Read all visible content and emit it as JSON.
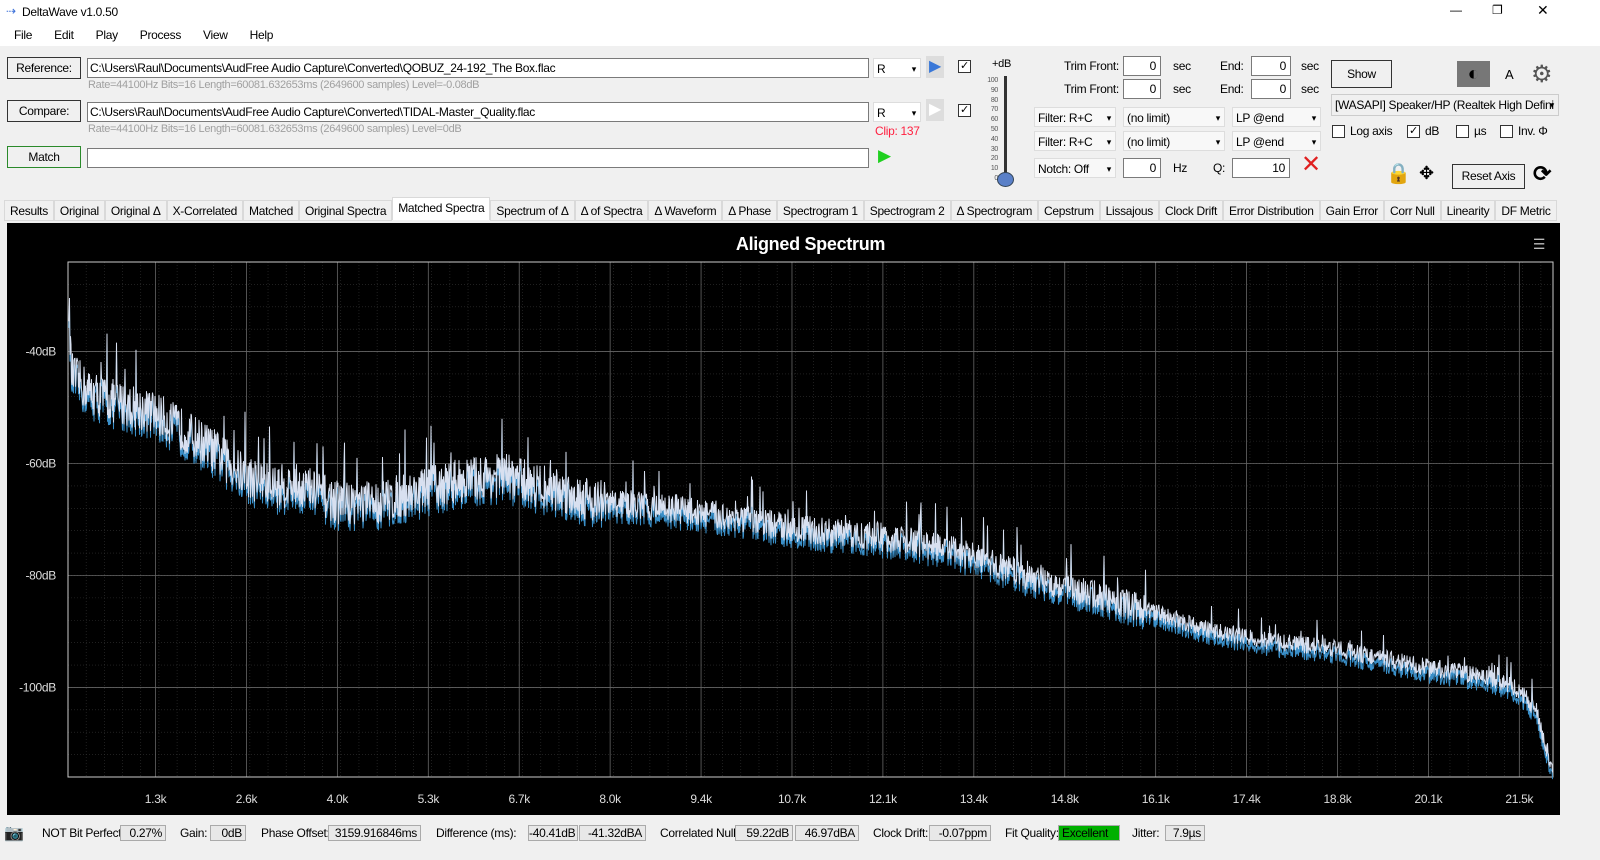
{
  "window": {
    "title": "DeltaWave v1.0.50",
    "controls": [
      "—",
      "❐",
      "✕"
    ]
  },
  "menu": [
    "File",
    "Edit",
    "Play",
    "Process",
    "View",
    "Help"
  ],
  "reference": {
    "label": "Reference:",
    "path": "C:\\Users\\Raul\\Documents\\AudFree Audio Capture\\Converted\\QOBUZ_24-192_The Box.flac",
    "info": "Rate=44100Hz Bits=16 Length=60081.632653ms (2649600 samples) Level=-0.08dB",
    "channel": "R",
    "checked": true
  },
  "compare": {
    "label": "Compare:",
    "path": "C:\\Users\\Raul\\Documents\\AudFree Audio Capture\\Converted\\TIDAL-Master_Quality.flac",
    "info": "Rate=44100Hz Bits=16 Length=60081.632653ms (2649600 samples) Level=0dB",
    "channel": "R",
    "clip": "Clip: 137",
    "checked": true
  },
  "match": {
    "label": "Match",
    "value": ""
  },
  "slider": {
    "label": "+dB",
    "ticks": [
      "100",
      "90",
      "80",
      "70",
      "60",
      "50",
      "40",
      "30",
      "20",
      "10",
      "0"
    ],
    "value": 0
  },
  "trim": {
    "front_label": "Trim Front:",
    "end_label": "End:",
    "unit": "sec",
    "ref_front": "0",
    "ref_end": "0",
    "cmp_front": "0",
    "cmp_end": "0"
  },
  "filters": {
    "f1": "Filter: R+C",
    "f2": "Filter: R+C",
    "l1": "(no limit)",
    "l2": "(no limit)",
    "lp1": "LP @end",
    "lp2": "LP @end",
    "notch": "Notch: Off",
    "notch_hz": "0",
    "hz": "Hz",
    "q_label": "Q:",
    "q": "10"
  },
  "right": {
    "show": "Show",
    "a": "A",
    "device": "[WASAPI] Speaker/HP (Realtek High Defini",
    "log_axis": "Log axis",
    "db": "dB",
    "us": "µs",
    "inv": "Inv. Φ",
    "reset_axis": "Reset Axis",
    "log_checked": false,
    "db_checked": true,
    "us_checked": false,
    "inv_checked": false
  },
  "tabs": [
    "Results",
    "Original",
    "Original Δ",
    "X-Correlated",
    "Matched",
    "Original Spectra",
    "Matched Spectra",
    "Spectrum of Δ",
    "Δ of Spectra",
    "Δ Waveform",
    "Δ Phase",
    "Spectrogram 1",
    "Spectrogram 2",
    "Δ Spectrogram",
    "Cepstrum",
    "Lissajous",
    "Clock Drift",
    "Error Distribution",
    "Gain Error",
    "Corr Null",
    "Linearity",
    "DF Metric"
  ],
  "active_tab": "Matched Spectra",
  "chart_data": {
    "type": "line",
    "title": "Aligned Spectrum",
    "xlabel": "",
    "ylabel": "",
    "xlim": [
      0,
      22.05
    ],
    "ylim": [
      -116,
      -24
    ],
    "grid": true,
    "yticks": [
      {
        "v": -40,
        "label": "-40dB"
      },
      {
        "v": -60,
        "label": "-60dB"
      },
      {
        "v": -80,
        "label": "-80dB"
      },
      {
        "v": -100,
        "label": "-100dB"
      }
    ],
    "xticks": [
      {
        "v": 1.3,
        "label": "1.3k"
      },
      {
        "v": 2.65,
        "label": "2.6k"
      },
      {
        "v": 4.0,
        "label": "4.0k"
      },
      {
        "v": 5.35,
        "label": "5.3k"
      },
      {
        "v": 6.7,
        "label": "6.7k"
      },
      {
        "v": 8.05,
        "label": "8.0k"
      },
      {
        "v": 9.4,
        "label": "9.4k"
      },
      {
        "v": 10.75,
        "label": "10.7k"
      },
      {
        "v": 12.1,
        "label": "12.1k"
      },
      {
        "v": 13.45,
        "label": "13.4k"
      },
      {
        "v": 14.8,
        "label": "14.8k"
      },
      {
        "v": 16.15,
        "label": "16.1k"
      },
      {
        "v": 17.5,
        "label": "17.4k"
      },
      {
        "v": 18.85,
        "label": "18.8k"
      },
      {
        "v": 20.2,
        "label": "20.1k"
      },
      {
        "v": 21.55,
        "label": "21.5k"
      }
    ],
    "x": [
      0,
      0.05,
      0.3,
      0.7,
      1.0,
      1.3,
      1.7,
      2.1,
      2.6,
      3.0,
      3.5,
      4.0,
      4.6,
      5.2,
      5.8,
      6.5,
      7.0,
      8.0,
      9.0,
      10.0,
      11.0,
      12.0,
      13.0,
      14.0,
      14.8,
      16.0,
      17.0,
      18.0,
      18.8,
      20.0,
      21.0,
      21.5,
      21.8,
      22.05
    ],
    "y": [
      -26,
      -44,
      -47,
      -49,
      -50,
      -51,
      -54,
      -57,
      -62,
      -64,
      -64,
      -67,
      -67,
      -65,
      -63,
      -62,
      -64,
      -67,
      -68,
      -70,
      -72,
      -73,
      -75,
      -79,
      -82,
      -86,
      -90,
      -92,
      -93,
      -96,
      -98,
      -100,
      -104,
      -115
    ],
    "color": "#d8e0f0"
  },
  "chart_series_title_note": "",
  "status": {
    "bit_perfect": "NOT Bit Perfect",
    "bit_pct": "0.27%",
    "gain_label": "Gain:",
    "gain": "0dB",
    "phase_label": "Phase Offset:",
    "phase": "3159.916846ms",
    "diff_label": "Difference (ms):",
    "diff1": "-40.41dB",
    "diff2": "-41.32dBA",
    "null_label": "Correlated Null:",
    "null1": "59.22dB",
    "null2": "46.97dBA",
    "drift_label": "Clock Drift:",
    "drift": "-0.07ppm",
    "fit_label": "Fit Quality:",
    "fit": "Excellent",
    "fit_color": "#00b000",
    "jitter_label": "Jitter:",
    "jitter": "7.9µs"
  }
}
